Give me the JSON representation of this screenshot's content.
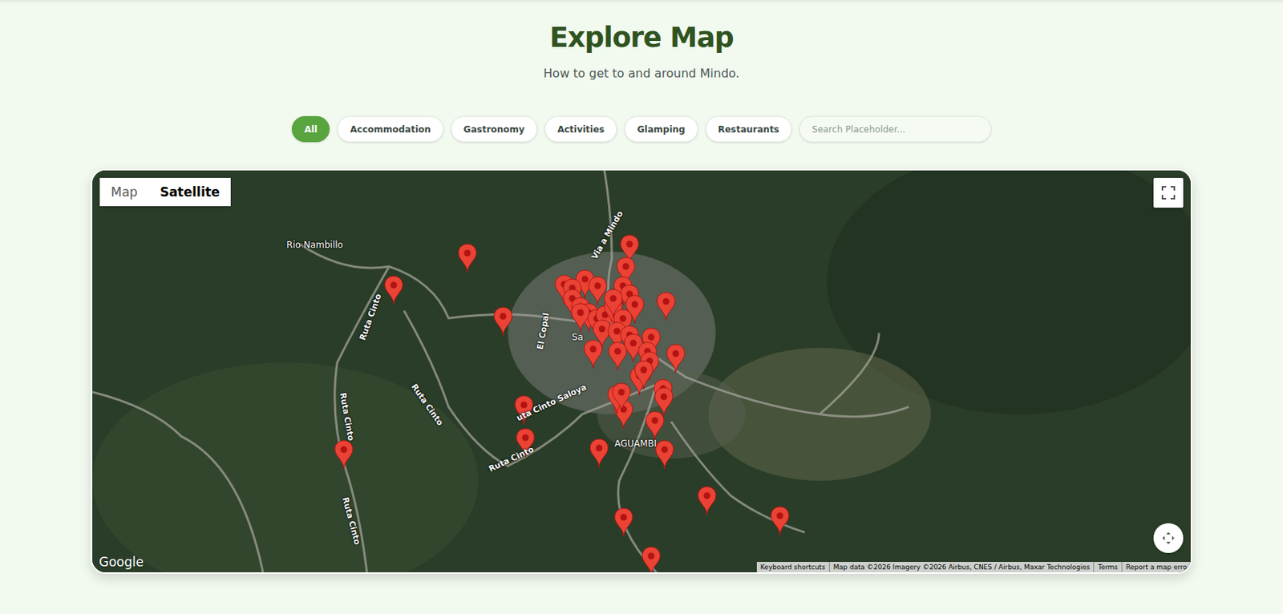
{
  "page": {
    "title": "Explore Map",
    "subtitle": "How to get to and around Mindo."
  },
  "filters": [
    {
      "label": "All",
      "selected": true
    },
    {
      "label": "Accommodation",
      "selected": false
    },
    {
      "label": "Gastronomy",
      "selected": false
    },
    {
      "label": "Activities",
      "selected": false
    },
    {
      "label": "Glamping",
      "selected": false
    },
    {
      "label": "Restaurants",
      "selected": false
    }
  ],
  "search": {
    "placeholder": "Search Placeholder..."
  },
  "map": {
    "types": [
      {
        "label": "Map",
        "selected": false
      },
      {
        "label": "Satellite",
        "selected": true
      }
    ],
    "labels": [
      {
        "text": "Rio Nambillo"
      },
      {
        "text": "Ruta Cinto"
      },
      {
        "text": "Ruta Cinto"
      },
      {
        "text": "Ruta Cinto"
      },
      {
        "text": "Ruta Cinto"
      },
      {
        "text": "Ruta Cinto"
      },
      {
        "text": "uta Cinto Saloya"
      },
      {
        "text": "El Copal"
      },
      {
        "text": "Via a Mindo"
      },
      {
        "text": "Sa"
      },
      {
        "text": "AGUAMBI"
      }
    ],
    "logo": "Google",
    "attribution": [
      "Keyboard shortcuts",
      "Map data ©2026 Imagery ©2026 Airbus, CNES / Airbus, Maxar Technologies",
      "Terms",
      "Report a map erro"
    ]
  }
}
